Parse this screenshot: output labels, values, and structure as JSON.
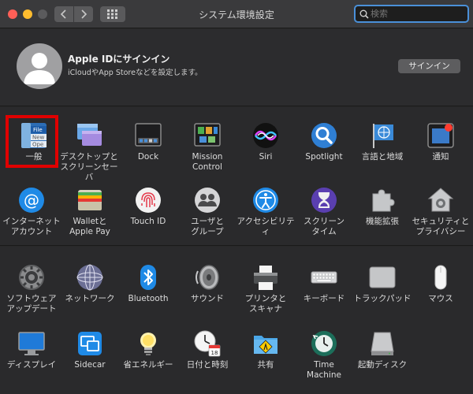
{
  "window": {
    "title": "システム環境設定"
  },
  "search": {
    "placeholder": "検索"
  },
  "apple_id": {
    "title": "Apple IDにサインイン",
    "subtitle": "iCloudやApp Storeなどを設定します。",
    "signin_label": "サインイン"
  },
  "panel1": [
    {
      "label": "一般",
      "icon": "general-icon"
    },
    {
      "label": "デスクトップと\nスクリーンセーバ",
      "icon": "desktop-screensaver-icon"
    },
    {
      "label": "Dock",
      "icon": "dock-icon"
    },
    {
      "label": "Mission\nControl",
      "icon": "mission-control-icon"
    },
    {
      "label": "Siri",
      "icon": "siri-icon"
    },
    {
      "label": "Spotlight",
      "icon": "spotlight-icon"
    },
    {
      "label": "言語と地域",
      "icon": "language-region-icon"
    },
    {
      "label": "通知",
      "icon": "notifications-icon"
    },
    {
      "label": "インターネット\nアカウント",
      "icon": "internet-accounts-icon"
    },
    {
      "label": "Walletと\nApple Pay",
      "icon": "wallet-icon"
    },
    {
      "label": "Touch ID",
      "icon": "touch-id-icon"
    },
    {
      "label": "ユーザと\nグループ",
      "icon": "users-groups-icon"
    },
    {
      "label": "アクセシビリティ",
      "icon": "accessibility-icon"
    },
    {
      "label": "スクリーン\nタイム",
      "icon": "screen-time-icon"
    },
    {
      "label": "機能拡張",
      "icon": "extensions-icon"
    },
    {
      "label": "セキュリティと\nプライバシー",
      "icon": "security-privacy-icon"
    }
  ],
  "panel2": [
    {
      "label": "ソフトウェア\nアップデート",
      "icon": "software-update-icon"
    },
    {
      "label": "ネットワーク",
      "icon": "network-icon"
    },
    {
      "label": "Bluetooth",
      "icon": "bluetooth-icon"
    },
    {
      "label": "サウンド",
      "icon": "sound-icon"
    },
    {
      "label": "プリンタと\nスキャナ",
      "icon": "printers-scanners-icon"
    },
    {
      "label": "キーボード",
      "icon": "keyboard-icon"
    },
    {
      "label": "トラックパッド",
      "icon": "trackpad-icon"
    },
    {
      "label": "マウス",
      "icon": "mouse-icon"
    },
    {
      "label": "ディスプレイ",
      "icon": "displays-icon"
    },
    {
      "label": "Sidecar",
      "icon": "sidecar-icon"
    },
    {
      "label": "省エネルギー",
      "icon": "energy-saver-icon"
    },
    {
      "label": "日付と時刻",
      "icon": "date-time-icon"
    },
    {
      "label": "共有",
      "icon": "sharing-icon"
    },
    {
      "label": "Time\nMachine",
      "icon": "time-machine-icon"
    },
    {
      "label": "起動ディスク",
      "icon": "startup-disk-icon"
    }
  ],
  "general_icon_text": [
    "File",
    "New",
    "Ope"
  ],
  "calendar_day": "18",
  "colors": {
    "accent": "#4a90d9",
    "highlight": "#e00000"
  }
}
